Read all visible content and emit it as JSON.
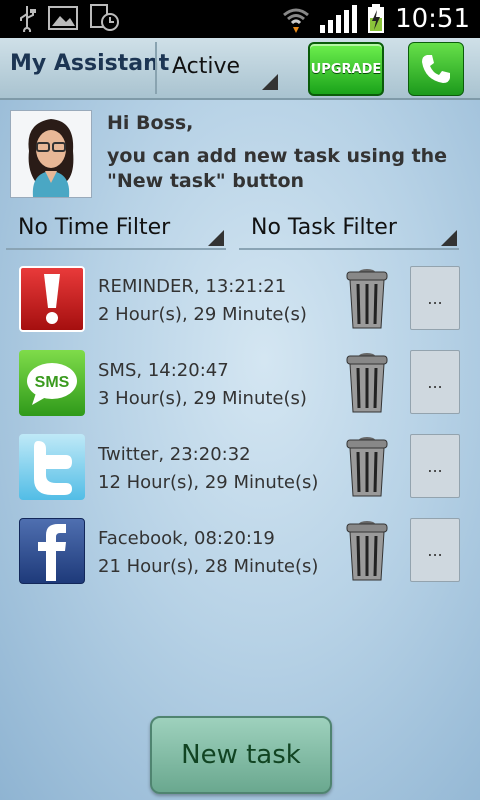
{
  "statusbar": {
    "time": "10:51",
    "icons": [
      "usb-icon",
      "image-icon",
      "clock-icon",
      "wifi-icon",
      "signal-icon",
      "battery-charging-icon"
    ]
  },
  "header": {
    "title": "My Assistant",
    "status_value": "Active",
    "upgrade_label": "UPGRADE",
    "call_icon": "phone-icon"
  },
  "greeting": {
    "title": "Hi Boss,",
    "message": "you can add new task using the \"New task\" button"
  },
  "filters": {
    "time_filter": "No Time Filter",
    "task_filter": "No Task Filter"
  },
  "tasks": [
    {
      "icon": "reminder-icon",
      "name": "REMINDER, 13:21:21",
      "remaining": "2 Hour(s), 29 Minute(s)",
      "more": "..."
    },
    {
      "icon": "sms-icon",
      "name": "SMS, 14:20:47",
      "remaining": "3 Hour(s), 29 Minute(s)",
      "more": "..."
    },
    {
      "icon": "twitter-icon",
      "name": "Twitter, 23:20:32",
      "remaining": "12 Hour(s), 29 Minute(s)",
      "more": "..."
    },
    {
      "icon": "facebook-icon",
      "name": "Facebook, 08:20:19",
      "remaining": "21 Hour(s), 28 Minute(s)",
      "more": "..."
    }
  ],
  "footer": {
    "new_task_label": "New task"
  },
  "colors": {
    "background": "#b7d2e6",
    "title_text": "#1c3553",
    "upgrade_green": "#1aa31a",
    "new_task_button": "#7fb8a0"
  }
}
